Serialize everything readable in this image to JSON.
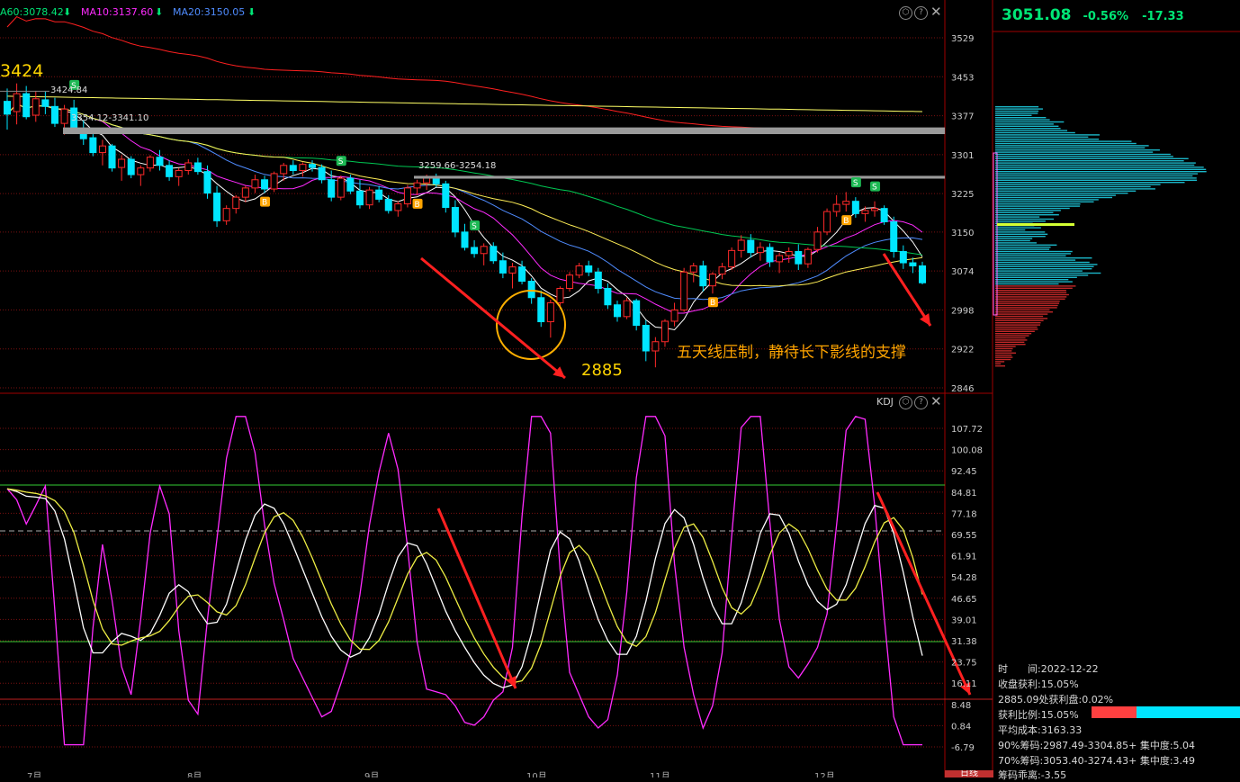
{
  "header": {
    "ma60_label": "A60:3078.42",
    "ma10_label": "MA10:3137.60",
    "ma20_label": "MA20:3150.05",
    "arrow": "⬇",
    "colors": {
      "ma60": "#00e676",
      "ma10": "#ff2bff",
      "ma20": "#4f8cff"
    }
  },
  "quote": {
    "price": "3051.08",
    "change_pct": "-0.56%",
    "change": "-17.33",
    "color": "#00e676"
  },
  "kdj_panel": {
    "title": "KDJ",
    "close_icon": "×",
    "help_icon": "?"
  },
  "price_axis": {
    "ticks": [
      "3529",
      "3453",
      "3377",
      "3301",
      "3225",
      "3150",
      "3074",
      "2998",
      "2922",
      "2846"
    ]
  },
  "kdj_axis": {
    "ticks": [
      "107.72",
      "100.08",
      "92.45",
      "84.81",
      "77.18",
      "69.55",
      "61.91",
      "54.28",
      "46.65",
      "39.01",
      "31.38",
      "23.75",
      "16.11",
      "8.48",
      "0.84",
      "-6.79"
    ]
  },
  "annotations": {
    "high_label": "3424",
    "high_line_label": "3424.84",
    "resistance1": "3354.12-3341.10",
    "resistance2": "3259.66-3254.18",
    "low_label": "2885",
    "comment": "五天线压制，静待长下影线的支撑"
  },
  "month_labels": [
    "7月",
    "8月",
    "9月",
    "10月",
    "11月",
    "12月"
  ],
  "chip_info": {
    "time_label": "时　　间:2022-12-22",
    "profit": "收盘获利:15.05%",
    "profit_at": "2885.09处获利盘:0.02%",
    "profit_ratio": "获利比例:15.05%",
    "avg_cost": "平均成本:3163.33",
    "chip90": "90%筹码:2987.49-3304.85+ 集中度:5.04",
    "chip70": "70%筹码:3053.40-3274.43+ 集中度:3.49",
    "divergence": "筹码乖离:-3.55",
    "profit_fraction": 0.1505
  },
  "bottom_tab": "日线",
  "chart_data": {
    "type": "candlestick",
    "price_range": [
      2846,
      3529
    ],
    "candles": [
      [
        3405,
        3430,
        3350,
        3380
      ],
      [
        3385,
        3440,
        3360,
        3420
      ],
      [
        3420,
        3435,
        3370,
        3375
      ],
      [
        3378,
        3425,
        3365,
        3410
      ],
      [
        3408,
        3424,
        3380,
        3395
      ],
      [
        3395,
        3412,
        3355,
        3362
      ],
      [
        3362,
        3398,
        3340,
        3390
      ],
      [
        3392,
        3408,
        3345,
        3350
      ],
      [
        3350,
        3368,
        3320,
        3332
      ],
      [
        3334,
        3345,
        3298,
        3305
      ],
      [
        3305,
        3330,
        3280,
        3318
      ],
      [
        3318,
        3322,
        3268,
        3275
      ],
      [
        3276,
        3300,
        3250,
        3292
      ],
      [
        3292,
        3298,
        3255,
        3262
      ],
      [
        3262,
        3280,
        3240,
        3275
      ],
      [
        3275,
        3300,
        3268,
        3296
      ],
      [
        3296,
        3310,
        3270,
        3280
      ],
      [
        3280,
        3290,
        3250,
        3258
      ],
      [
        3258,
        3275,
        3240,
        3270
      ],
      [
        3270,
        3292,
        3262,
        3285
      ],
      [
        3285,
        3295,
        3262,
        3268
      ],
      [
        3268,
        3280,
        3215,
        3226
      ],
      [
        3226,
        3240,
        3160,
        3172
      ],
      [
        3172,
        3202,
        3164,
        3196
      ],
      [
        3196,
        3222,
        3186,
        3218
      ],
      [
        3218,
        3240,
        3208,
        3236
      ],
      [
        3236,
        3262,
        3226,
        3252
      ],
      [
        3252,
        3260,
        3226,
        3234
      ],
      [
        3234,
        3268,
        3228,
        3264
      ],
      [
        3264,
        3285,
        3250,
        3280
      ],
      [
        3280,
        3290,
        3262,
        3270
      ],
      [
        3270,
        3286,
        3258,
        3282
      ],
      [
        3282,
        3290,
        3268,
        3276
      ],
      [
        3276,
        3282,
        3245,
        3252
      ],
      [
        3252,
        3270,
        3210,
        3218
      ],
      [
        3218,
        3260,
        3212,
        3255
      ],
      [
        3255,
        3262,
        3224,
        3230
      ],
      [
        3230,
        3252,
        3196,
        3203
      ],
      [
        3203,
        3238,
        3195,
        3232
      ],
      [
        3232,
        3240,
        3208,
        3214
      ],
      [
        3214,
        3222,
        3186,
        3192
      ],
      [
        3192,
        3210,
        3180,
        3205
      ],
      [
        3205,
        3242,
        3198,
        3236
      ],
      [
        3236,
        3252,
        3222,
        3246
      ],
      [
        3246,
        3262,
        3232,
        3256
      ],
      [
        3256,
        3264,
        3238,
        3244
      ],
      [
        3244,
        3250,
        3188,
        3198
      ],
      [
        3198,
        3212,
        3140,
        3150
      ],
      [
        3150,
        3166,
        3114,
        3120
      ],
      [
        3120,
        3134,
        3100,
        3108
      ],
      [
        3108,
        3128,
        3085,
        3122
      ],
      [
        3122,
        3130,
        3088,
        3094
      ],
      [
        3094,
        3110,
        3060,
        3070
      ],
      [
        3070,
        3090,
        3040,
        3082
      ],
      [
        3082,
        3094,
        3048,
        3054
      ],
      [
        3054,
        3060,
        3010,
        3022
      ],
      [
        3022,
        3036,
        2965,
        2975
      ],
      [
        2975,
        3018,
        2944,
        3012
      ],
      [
        3012,
        3044,
        3000,
        3040
      ],
      [
        3040,
        3072,
        3034,
        3066
      ],
      [
        3066,
        3090,
        3060,
        3084
      ],
      [
        3084,
        3094,
        3064,
        3072
      ],
      [
        3072,
        3080,
        3030,
        3040
      ],
      [
        3040,
        3050,
        3000,
        3008
      ],
      [
        3008,
        3016,
        2975,
        2985
      ],
      [
        2985,
        3022,
        2980,
        3016
      ],
      [
        3016,
        3020,
        2958,
        2968
      ],
      [
        2968,
        2978,
        2898,
        2918
      ],
      [
        2918,
        2945,
        2886,
        2936
      ],
      [
        2936,
        2980,
        2926,
        2976
      ],
      [
        2976,
        3012,
        2966,
        2998
      ],
      [
        2998,
        3080,
        2994,
        3072
      ],
      [
        3072,
        3090,
        3052,
        3084
      ],
      [
        3084,
        3094,
        3034,
        3045
      ],
      [
        3045,
        3072,
        3030,
        3068
      ],
      [
        3068,
        3090,
        3058,
        3082
      ],
      [
        3082,
        3120,
        3076,
        3114
      ],
      [
        3114,
        3144,
        3100,
        3134
      ],
      [
        3134,
        3146,
        3100,
        3110
      ],
      [
        3110,
        3130,
        3094,
        3120
      ],
      [
        3120,
        3128,
        3082,
        3092
      ],
      [
        3092,
        3110,
        3070,
        3104
      ],
      [
        3104,
        3120,
        3090,
        3112
      ],
      [
        3112,
        3126,
        3076,
        3088
      ],
      [
        3088,
        3120,
        3080,
        3116
      ],
      [
        3116,
        3160,
        3110,
        3150
      ],
      [
        3150,
        3196,
        3144,
        3190
      ],
      [
        3190,
        3222,
        3180,
        3204
      ],
      [
        3204,
        3228,
        3190,
        3210
      ],
      [
        3210,
        3218,
        3178,
        3186
      ],
      [
        3186,
        3200,
        3170,
        3192
      ],
      [
        3192,
        3210,
        3180,
        3196
      ],
      [
        3196,
        3202,
        3164,
        3170
      ],
      [
        3170,
        3180,
        3100,
        3112
      ],
      [
        3112,
        3124,
        3078,
        3090
      ],
      [
        3090,
        3100,
        3070,
        3084
      ],
      [
        3084,
        3092,
        3048,
        3051
      ]
    ],
    "bottom_candle_value_label": "2885",
    "kdj": {
      "k": [
        86,
        84,
        80,
        82,
        84,
        66,
        40,
        20,
        18,
        30,
        40,
        36,
        30,
        26,
        34,
        46,
        56,
        58,
        46,
        36,
        30,
        38,
        48,
        62,
        76,
        84,
        84,
        78,
        70,
        62,
        52,
        44,
        36,
        28,
        24,
        24,
        26,
        34,
        46,
        58,
        70,
        72,
        66,
        54,
        44,
        38,
        32,
        26,
        20,
        16,
        14,
        14,
        14,
        20,
        40,
        62,
        76,
        78,
        66,
        52,
        44,
        34,
        26,
        22,
        24,
        34,
        52,
        72,
        86,
        84,
        72,
        60,
        48,
        36,
        32,
        34,
        48,
        66,
        80,
        86,
        76,
        64,
        54,
        46,
        42,
        40,
        42,
        54,
        70,
        84,
        86,
        80,
        66,
        48,
        30,
        16,
        10
      ]
    }
  }
}
